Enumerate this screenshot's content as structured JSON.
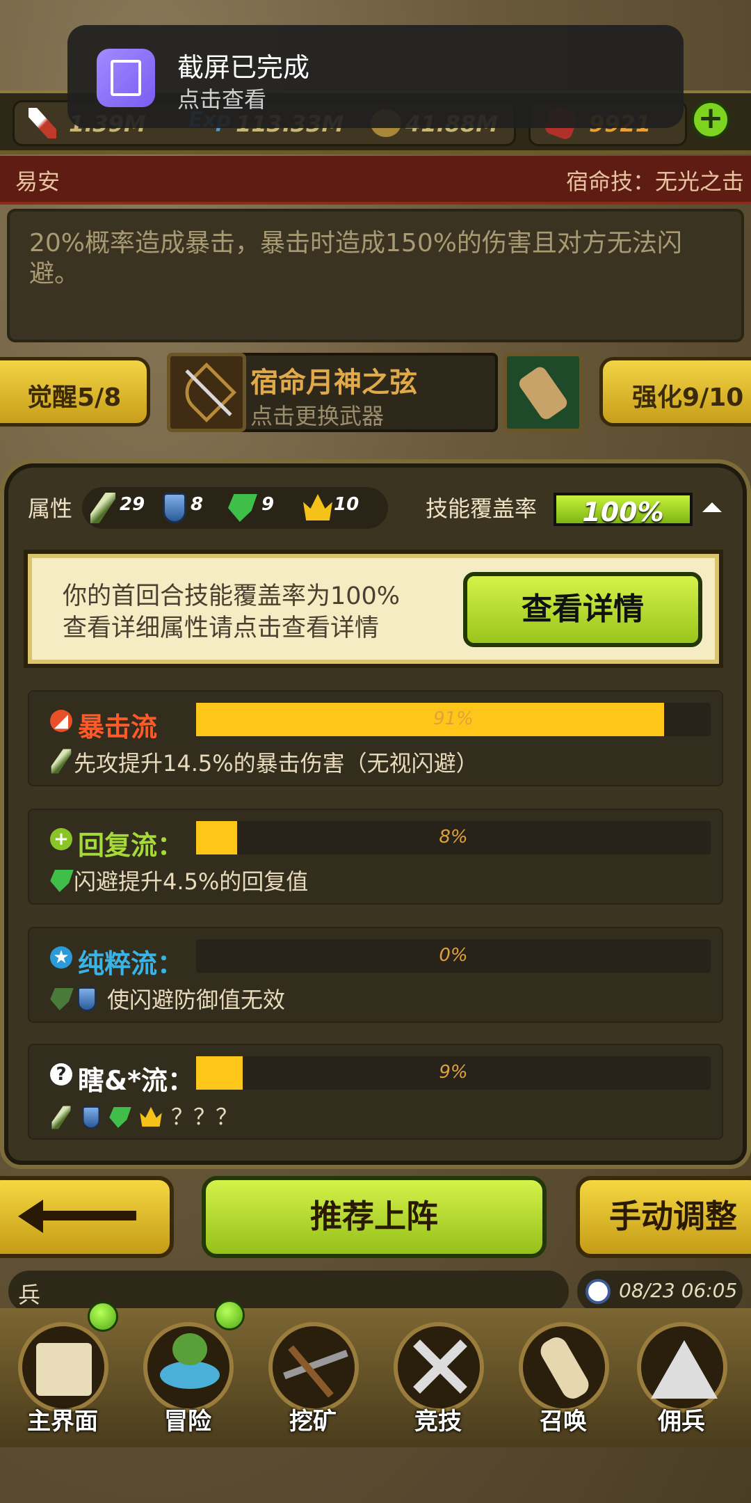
{
  "notification": {
    "title": "截屏已完成",
    "subtitle": "点击查看"
  },
  "resources": {
    "attack": "1.39M",
    "exp_label": "Exp",
    "exp": "113.33M",
    "gold": "41.88M",
    "gems": "9921"
  },
  "hero": {
    "name": "易安",
    "fate_skill": "宿命技：无光之击"
  },
  "description": "20%概率造成暴击，暴击时造成150%的伤害且对方无法闪避。",
  "weapon": {
    "awaken": "觉醒5/8",
    "name": "宿命月神之弦",
    "change_hint": "点击更换武器",
    "enhance": "强化9/10"
  },
  "attributes": {
    "label": "属性",
    "sword": "29",
    "shield": "8",
    "gem": "9",
    "crown": "10"
  },
  "coverage": {
    "label": "技能覆盖率",
    "value": 100,
    "text": "100%"
  },
  "info": {
    "line1": "你的首回合技能覆盖率为100%",
    "line2": "查看详细属性请点击查看详情",
    "button": "查看详情"
  },
  "flows": [
    {
      "title": "暴击流",
      "percent": 91,
      "text": "91%",
      "desc": "先攻提升14.5%的暴击伤害（无视闪避）",
      "color": "#ff5a2a"
    },
    {
      "title": "回复流：",
      "percent": 8,
      "text": "8%",
      "desc": "闪避提升4.5%的回复值",
      "color": "#a6d93a"
    },
    {
      "title": "纯粹流：",
      "percent": 0,
      "text": "0%",
      "desc": "使闪避防御值无效",
      "color": "#3ab4e6"
    },
    {
      "title": "瞎&*流：",
      "percent": 9,
      "text": "9%",
      "desc": "？？？",
      "color": "#ffffff"
    }
  ],
  "buttons": {
    "recommend": "推荐上阵",
    "manual": "手动调整"
  },
  "chat": {
    "text": "兵",
    "time": "08/23 06:05"
  },
  "nav": [
    {
      "label": "主界面",
      "icon": "map-scroll-icon"
    },
    {
      "label": "冒险",
      "icon": "island-icon"
    },
    {
      "label": "挖矿",
      "icon": "pickaxe-icon"
    },
    {
      "label": "竞技",
      "icon": "crossed-swords-icon"
    },
    {
      "label": "召唤",
      "icon": "summon-scroll-icon"
    },
    {
      "label": "佣兵",
      "icon": "tent-icon"
    }
  ]
}
